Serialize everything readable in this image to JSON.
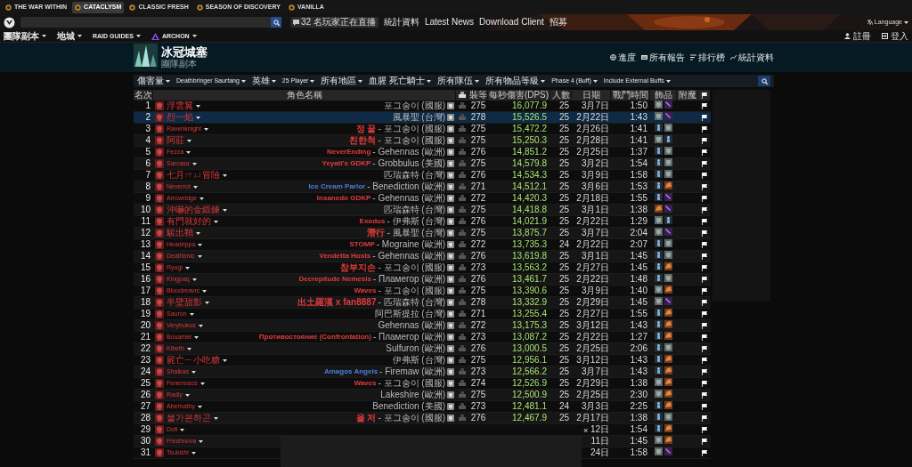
{
  "game_tabs": [
    {
      "label": "THE WAR WITHIN",
      "selected": false
    },
    {
      "label": "CATACLYSM",
      "selected": true
    },
    {
      "label": "CLASSIC FRESH",
      "selected": false
    },
    {
      "label": "SEASON OF DISCOVERY",
      "selected": false
    },
    {
      "label": "VANILLA",
      "selected": false
    }
  ],
  "live_button": "32 名玩家正在直播",
  "top_links": [
    "統計資料",
    "Latest News",
    "Download Client",
    "招募"
  ],
  "language": "Language",
  "nav": [
    {
      "label": "團隊副本",
      "kind": "plain"
    },
    {
      "label": "地城",
      "kind": "plain"
    },
    {
      "label": "RAID GUIDES",
      "kind": "plain"
    },
    {
      "label": "ARCHON",
      "kind": "archon"
    }
  ],
  "account": [
    {
      "label": "註冊",
      "kind": "register"
    },
    {
      "label": "登入",
      "kind": "login"
    }
  ],
  "zone": {
    "title": "冰冠城塞",
    "subtitle": "團隊副本"
  },
  "zone_links": [
    {
      "label": "進度",
      "kind": "globe"
    },
    {
      "label": "所有報告",
      "kind": "reports"
    },
    {
      "label": "排行榜",
      "kind": "rankings"
    },
    {
      "label": "統計資料",
      "kind": "stats"
    }
  ],
  "filters": [
    "傷害量",
    "Deathbringer Saurfang",
    "英雄",
    "25 Player",
    "所有地區",
    "血腥 死亡騎士",
    "所有隊伍",
    "所有物品等級",
    "Phase 4 (Buff)",
    "Include External Buffs"
  ],
  "table": {
    "columns": [
      "名次",
      "角色名稱",
      "裝等",
      "每秒傷害(DPS)",
      "人數",
      "日期",
      "戰鬥時間",
      "飾品",
      "附魔"
    ],
    "rows": [
      {
        "rank": "1",
        "name": "浮雲翼",
        "server": "포그송이 (國服)",
        "ilvl": "275",
        "dps": "16,077.9",
        "size": "25",
        "date": "3月7日",
        "duration": "1:50",
        "gear": [
          {
            "kind": "plate"
          },
          {
            "kind": "blade"
          }
        ],
        "selected": false
      },
      {
        "rank": "2",
        "name": "烈一焰",
        "server": "風暴聖 (台灣)",
        "ilvl": "278",
        "dps": "15,526.5",
        "size": "25",
        "date": "2月22日",
        "duration": "1:43",
        "gear": [
          {
            "kind": "plate"
          },
          {
            "kind": "blade"
          }
        ],
        "selected": true
      },
      {
        "rank": "3",
        "name": "Ravenknight",
        "guild": {
          "name": "정 꿀",
          "color": "#e03c3c"
        },
        "server": "- 포그송이 (國服)",
        "ilvl": "275",
        "dps": "15,472.2",
        "size": "25",
        "date": "2月26日",
        "duration": "1:41",
        "gear": [
          {
            "kind": "figure"
          },
          {
            "kind": "plate"
          }
        ],
        "selected": false
      },
      {
        "rank": "4",
        "name": "阿莊",
        "guild": {
          "name": "친한척",
          "color": "#e03c3c"
        },
        "server": "- 포그송이 (國服)",
        "ilvl": "275",
        "dps": "15,250.3",
        "size": "25",
        "date": "2月28日",
        "duration": "1:41",
        "gear": [
          {
            "kind": "plate"
          },
          {
            "kind": "figure"
          }
        ],
        "selected": false
      },
      {
        "rank": "5",
        "name": "Fezza",
        "guild": {
          "name": "NeverEnding",
          "color": "#e03c3c"
        },
        "server": "- Gehennas (歐洲)",
        "ilvl": "276",
        "dps": "14,851.2",
        "size": "25",
        "date": "2月25日",
        "duration": "1:37",
        "gear": [
          {
            "kind": "figure"
          },
          {
            "kind": "plate"
          }
        ],
        "selected": false
      },
      {
        "rank": "6",
        "name": "Sarcasa",
        "guild": {
          "name": "Yeyati's GDKP",
          "color": "#e03c3c"
        },
        "server": "- Grobbulus (美國)",
        "ilvl": "275",
        "dps": "14,579.8",
        "size": "25",
        "date": "3月2日",
        "duration": "1:54",
        "gear": [
          {
            "kind": "figure"
          },
          {
            "kind": "plate"
          }
        ],
        "selected": false
      },
      {
        "rank": "7",
        "name": "七月ㄇㄩ冒險",
        "server": "匹瑞森特 (台灣)",
        "ilvl": "276",
        "dps": "14,534.3",
        "size": "25",
        "date": "3月9日",
        "duration": "1:58",
        "gear": [
          {
            "kind": "figure"
          },
          {
            "kind": "plate"
          }
        ],
        "selected": false
      },
      {
        "rank": "8",
        "name": "Neverrot",
        "guild": {
          "name": "Ice Cream Parlor",
          "color": "#4a7fe0"
        },
        "server": "- Benediction (歐洲)",
        "ilvl": "271",
        "dps": "14,512.1",
        "size": "25",
        "date": "3月6日",
        "duration": "1:53",
        "gear": [
          {
            "kind": "figure"
          },
          {
            "kind": "ore"
          }
        ],
        "selected": false
      },
      {
        "rank": "9",
        "name": "Arrowridge",
        "guild": {
          "name": "Insanedo GDKP",
          "color": "#e03c3c"
        },
        "server": "- Gehennas (歐洲)",
        "ilvl": "272",
        "dps": "14,420.3",
        "size": "25",
        "date": "2月18日",
        "duration": "1:55",
        "gear": [
          {
            "kind": "figure"
          },
          {
            "kind": "blade"
          }
        ],
        "selected": false
      },
      {
        "rank": "10",
        "name": "沖嚇的金鍛鍊",
        "server": "匹瑞森特 (台灣)",
        "ilvl": "275",
        "dps": "14,418.8",
        "size": "25",
        "date": "3月1日",
        "duration": "1:38",
        "gear": [
          {
            "kind": "ore"
          },
          {
            "kind": "blade"
          }
        ],
        "selected": false
      },
      {
        "rank": "11",
        "name": "有門就好的",
        "guild": {
          "name": "Exodus",
          "color": "#e03c3c"
        },
        "server": "- 伊弗斯 (台灣)",
        "ilvl": "276",
        "dps": "14,021.9",
        "size": "25",
        "date": "2月22日",
        "duration": "1:29",
        "gear": [
          {
            "kind": "plate"
          },
          {
            "kind": "figure"
          }
        ],
        "selected": false
      },
      {
        "rank": "12",
        "name": "駿出鞘",
        "guild": {
          "name": "潛行",
          "color": "#e03c3c"
        },
        "server": "- 風暴聖 (台灣)",
        "ilvl": "275",
        "dps": "13,875.7",
        "size": "25",
        "date": "3月7日",
        "duration": "2:04",
        "gear": [
          {
            "kind": "plate"
          },
          {
            "kind": "blade"
          }
        ],
        "selected": false
      },
      {
        "rank": "13",
        "name": "Headrippa",
        "guild": {
          "name": "STOMP",
          "color": "#e03c3c"
        },
        "server": "- Mograine (歐洲)",
        "ilvl": "272",
        "dps": "13,735.3",
        "size": "24",
        "date": "2月22日",
        "duration": "2:07",
        "gear": [
          {
            "kind": "figure"
          },
          {
            "kind": "plate"
          }
        ],
        "selected": false
      },
      {
        "rank": "14",
        "name": "Deathbnic",
        "guild": {
          "name": "Vendetta Hosts",
          "color": "#e03c3c"
        },
        "server": "- Gehennas (歐洲)",
        "ilvl": "276",
        "dps": "13,619.8",
        "size": "25",
        "date": "3月1日",
        "duration": "1:45",
        "gear": [
          {
            "kind": "figure"
          },
          {
            "kind": "plate"
          }
        ],
        "selected": false
      },
      {
        "rank": "15",
        "name": "Ryugi",
        "guild": {
          "name": "참부지손",
          "color": "#e03c3c"
        },
        "server": "- 포그송이 (國服)",
        "ilvl": "273",
        "dps": "13,563.2",
        "size": "25",
        "date": "2月27日",
        "duration": "1:45",
        "gear": [
          {
            "kind": "figure"
          },
          {
            "kind": "ore"
          }
        ],
        "selected": false
      },
      {
        "rank": "16",
        "name": "Kingpaq",
        "guild": {
          "name": "Decrepitude Nemesis",
          "color": "#e03c3c"
        },
        "server": "- Пламегор (歐洲)",
        "ilvl": "276",
        "dps": "13,461.7",
        "size": "25",
        "date": "2月22日",
        "duration": "1:48",
        "gear": [
          {
            "kind": "figure"
          },
          {
            "kind": "plate"
          }
        ],
        "selected": false
      },
      {
        "rank": "17",
        "name": "Bloodreavrc",
        "guild": {
          "name": "Waves",
          "color": "#e03c3c"
        },
        "server": "- 포그송이 (國服)",
        "ilvl": "275",
        "dps": "13,390.6",
        "size": "25",
        "date": "3月9日",
        "duration": "1:40",
        "gear": [
          {
            "kind": "plate"
          },
          {
            "kind": "ore"
          }
        ],
        "selected": false
      },
      {
        "rank": "18",
        "name": "半壁甜影",
        "guild": {
          "name": "出土羅漢 x fan8887",
          "color": "#e03c3c"
        },
        "server": "- 匹瑞森特 (台灣)",
        "ilvl": "278",
        "dps": "13,332.9",
        "size": "25",
        "date": "2月29日",
        "duration": "1:45",
        "gear": [
          {
            "kind": "plate"
          },
          {
            "kind": "blade"
          }
        ],
        "selected": false
      },
      {
        "rank": "19",
        "name": "Sauron",
        "server": "阿巴斯提拉 (台灣)",
        "ilvl": "271",
        "dps": "13,255.4",
        "size": "25",
        "date": "2月27日",
        "duration": "1:55",
        "gear": [
          {
            "kind": "figure"
          },
          {
            "kind": "ore"
          }
        ],
        "selected": false
      },
      {
        "rank": "20",
        "name": "Verybokus",
        "server": "Gehennas (歐洲)",
        "ilvl": "272",
        "dps": "13,175.3",
        "size": "25",
        "date": "3月12日",
        "duration": "1:43",
        "gear": [
          {
            "kind": "figure"
          },
          {
            "kind": "ore"
          }
        ],
        "selected": false
      },
      {
        "rank": "21",
        "name": "Bouamer",
        "guild": {
          "name": "Противостояние (Confrontation)",
          "color": "#e03c3c"
        },
        "server": "- Пламегор (歐洲)",
        "ilvl": "273",
        "dps": "13,087.2",
        "size": "25",
        "date": "2月22日",
        "duration": "1:27",
        "gear": [
          {
            "kind": "figure"
          },
          {
            "kind": "ore"
          }
        ],
        "selected": false
      },
      {
        "rank": "22",
        "name": "Kibeth",
        "server": "Sulfuron (歐洲)",
        "ilvl": "276",
        "dps": "13,000.5",
        "size": "25",
        "date": "2月25日",
        "duration": "2:06",
        "gear": [
          {
            "kind": "figure"
          },
          {
            "kind": "plate"
          }
        ],
        "selected": false
      },
      {
        "rank": "23",
        "name": "屍亡ㄧ小吃糖",
        "server": "伊弗斯 (台灣)",
        "ilvl": "275",
        "dps": "12,956.1",
        "size": "25",
        "date": "3月12日",
        "duration": "1:43",
        "gear": [
          {
            "kind": "figure"
          },
          {
            "kind": "ore"
          }
        ],
        "selected": false
      },
      {
        "rank": "24",
        "name": "Shalkas",
        "guild": {
          "name": "Amagos Angels",
          "color": "#4a7fe0"
        },
        "server": "- Firemaw (歐洲)",
        "ilvl": "273",
        "dps": "12,566.2",
        "size": "25",
        "date": "3月7日",
        "duration": "1:43",
        "gear": [
          {
            "kind": "figure"
          },
          {
            "kind": "ore"
          }
        ],
        "selected": false
      },
      {
        "rank": "25",
        "name": "Fenenosos",
        "guild": {
          "name": "Waves",
          "color": "#e03c3c"
        },
        "server": "- 포그송이 (國服)",
        "ilvl": "274",
        "dps": "12,526.9",
        "size": "25",
        "date": "2月29日",
        "duration": "1:38",
        "gear": [
          {
            "kind": "plate"
          },
          {
            "kind": "ore"
          }
        ],
        "selected": false
      },
      {
        "rank": "26",
        "name": "Radiy",
        "server": "Lakeshire (歐洲)",
        "ilvl": "275",
        "dps": "12,500.9",
        "size": "25",
        "date": "2月25日",
        "duration": "2:30",
        "gear": [
          {
            "kind": "plate"
          },
          {
            "kind": "ore"
          }
        ],
        "selected": false
      },
      {
        "rank": "27",
        "name": "Abernathy",
        "server": "Benediction (美國)",
        "ilvl": "273",
        "dps": "12,481.1",
        "size": "24",
        "date": "3月3日",
        "duration": "2:25",
        "gear": [
          {
            "kind": "figure"
          },
          {
            "kind": "ore"
          }
        ],
        "selected": false
      },
      {
        "rank": "28",
        "name": "불가은하곤",
        "guild": {
          "name": "을 저",
          "color": "#e03c3c"
        },
        "server": "- 포그송이 (國服)",
        "ilvl": "276",
        "dps": "12,467.9",
        "size": "25",
        "date": "2月17日",
        "duration": "1:38",
        "gear": [
          {
            "kind": "figure"
          },
          {
            "kind": "plate"
          }
        ],
        "selected": false
      },
      {
        "rank": "29",
        "name": "Dofi",
        "date": "12日",
        "duration": "1:54",
        "gear": [
          {
            "kind": "figure"
          },
          {
            "kind": "ore"
          }
        ],
        "selected": false
      },
      {
        "rank": "30",
        "name": "Freshnova",
        "date": "11日",
        "duration": "1:45",
        "gear": [
          {
            "kind": "plate"
          },
          {
            "kind": "ore"
          }
        ],
        "selected": false
      },
      {
        "rank": "31",
        "name": "Tsukishi",
        "date": "24日",
        "duration": "1:58",
        "gear": [
          {
            "kind": "plate"
          },
          {
            "kind": "blade"
          }
        ],
        "selected": false
      }
    ]
  },
  "overlay": {
    "close": "×"
  }
}
